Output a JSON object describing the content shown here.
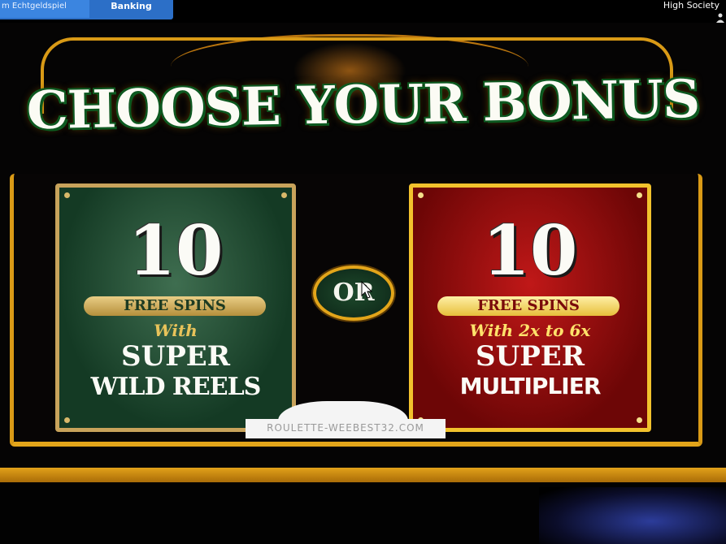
{
  "topbar": {
    "tab_real": "m Echtgeldspiel",
    "tab_banking": "Banking",
    "game_name": "High Society"
  },
  "title": "CHOOSE YOUR BONUS",
  "cards": {
    "left": {
      "number": "10",
      "pill": "FREE SPINS",
      "with": "With",
      "super": "SUPER",
      "feature": "WILD REELS",
      "colors": {
        "background": "#1f4a30",
        "border": "#c8a35b"
      }
    },
    "right": {
      "number": "10",
      "pill": "FREE SPINS",
      "with": "With 2x to 6x",
      "super": "SUPER",
      "feature": "MULTIPLIER",
      "colors": {
        "background": "#9c0f0f",
        "border": "#f2c22d"
      }
    }
  },
  "or_label": "OR",
  "watermark": "ROULETTE-WEEBEST32.COM",
  "icons": [
    "user-icon",
    "cursor-icon"
  ],
  "colors": {
    "gold": "#d99a16",
    "title_outline": "#0d5d22"
  }
}
